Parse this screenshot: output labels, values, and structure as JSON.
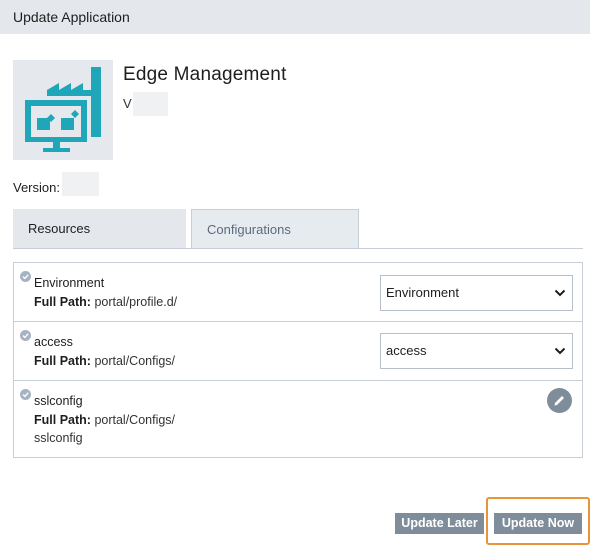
{
  "dialog": {
    "title": "Update Application"
  },
  "app": {
    "name": "Edge Management",
    "version_prefix": "V",
    "icon": "factory-monitor-icon",
    "icon_colors": {
      "accent": "#1fa6b8",
      "background": "#e5e8ec"
    }
  },
  "version": {
    "label": "Version:"
  },
  "tabs": [
    {
      "label": "Resources",
      "selected": false
    },
    {
      "label": "Configurations",
      "selected": true
    }
  ],
  "configs": [
    {
      "name": "Environment",
      "path_label": "Full Path:",
      "path": "portal/profile.d/",
      "control": "select",
      "selected": "Environment"
    },
    {
      "name": "access",
      "path_label": "Full Path:",
      "path": "portal/Configs/",
      "control": "select",
      "selected": "access"
    },
    {
      "name": "sslconfig",
      "path_label": "Full Path:",
      "path": "portal/Configs/",
      "path_cont": "sslconfig",
      "control": "edit"
    }
  ],
  "buttons": {
    "update_later": "Update Later",
    "update_now": "Update Now"
  },
  "colors": {
    "header_bg": "#e4e8ed",
    "button_bg": "#7f8d9b",
    "focus_ring": "#e8953a"
  }
}
